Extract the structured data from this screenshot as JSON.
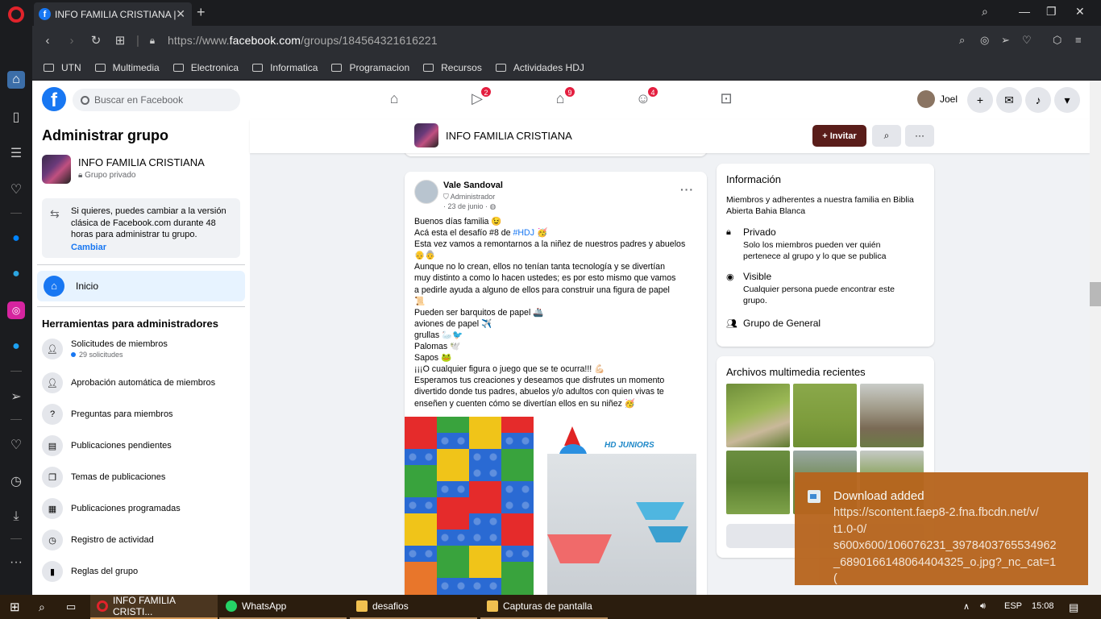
{
  "browser": {
    "tab_title": "INFO FAMILIA CRISTIANA |",
    "url_prefix": "https://www.",
    "url_domain": "facebook.com",
    "url_path": "/groups/184564321616221",
    "bookmarks": [
      "UTN",
      "Multimedia",
      "Electronica",
      "Informatica",
      "Programacion",
      "Recursos",
      "Actividades HDJ"
    ]
  },
  "fb_header": {
    "search_placeholder": "Buscar en Facebook",
    "badges": {
      "watch": "2",
      "marketplace": "9",
      "groups": "4"
    },
    "user_name": "Joel"
  },
  "admin_panel": {
    "title": "Administrar grupo",
    "group_name": "INFO FAMILIA CRISTIANA",
    "group_privacy": "Grupo privado",
    "switch_text": "Si quieres, puedes cambiar a la versión clásica de Facebook.com durante 48 horas para administrar tu grupo.",
    "switch_link": "Cambiar",
    "home_label": "Inicio",
    "tools_heading": "Herramientas para administradores",
    "tools": [
      {
        "label": "Solicitudes de miembros",
        "sub": "29 solicitudes"
      },
      {
        "label": "Aprobación automática de miembros"
      },
      {
        "label": "Preguntas para miembros"
      },
      {
        "label": "Publicaciones pendientes"
      },
      {
        "label": "Temas de publicaciones"
      },
      {
        "label": "Publicaciones programadas"
      },
      {
        "label": "Registro de actividad"
      },
      {
        "label": "Reglas del grupo"
      }
    ]
  },
  "group_bar": {
    "name": "INFO FAMILIA CRISTIANA",
    "invite_label": "+ Invitar",
    "more_label": "···"
  },
  "post": {
    "author": "Vale Sandoval",
    "role": "Administrador",
    "date": "· 23 de junio ·",
    "lines": [
      "Buenos días familia 😉",
      "Acá esta el desafío #8 de ",
      "Esta vez vamos a remontarnos a la niñez de nuestros padres y abuelos",
      "👴👵",
      "Aunque no lo crean, ellos no tenían tanta tecnología y se divertían",
      "muy distinto a como lo hacen ustedes; es por esto mismo que vamos",
      "a pedirle ayuda a alguno de ellos para construir una figura de papel",
      "📜",
      "Pueden ser barquitos de papel 🚢",
      "aviones de papel ✈️",
      "grullas 🦢🐦",
      "Palomas 🕊️",
      "Sapos 🐸",
      "¡¡¡O cualquier figura o juego que se te ocurra!!! 💪🏻",
      "Esperamos tus creaciones y deseamos que disfrutes un momento",
      "divertido donde tus padres, abuelos y/o adultos con quien vivas te",
      "enseñen y cuenten cómo se divertían ellos en su niñez 🥳"
    ],
    "hashtag": "#HDJ",
    "hashtag_suffix": " 🥳",
    "image_caption": "HD JUNIORS"
  },
  "info_card": {
    "heading": "Información",
    "description": "Miembros y adherentes a nuestra familia en Biblia Abierta Bahia Blanca",
    "private_title": "Privado",
    "private_desc": "Solo los miembros pueden ver quién pertenece al grupo y lo que se publica",
    "visible_title": "Visible",
    "visible_desc": "Cualquier persona puede encontrar este grupo.",
    "general_title": "Grupo de General"
  },
  "media_card": {
    "heading": "Archivos multimedia recientes"
  },
  "download_toast": {
    "title": "Download added",
    "body": "https://scontent.faep8-2.fna.fbcdn.net/v/\nt1.0-0/\ns600x600/106076231_3978403765534962\n_6890166148064404325_o.jpg?_nc_cat=1("
  },
  "taskbar": {
    "items": [
      "INFO FAMILIA CRISTI...",
      "WhatsApp",
      "desafios",
      "Capturas de pantalla"
    ],
    "lang": "ESP",
    "time": "15:08"
  }
}
